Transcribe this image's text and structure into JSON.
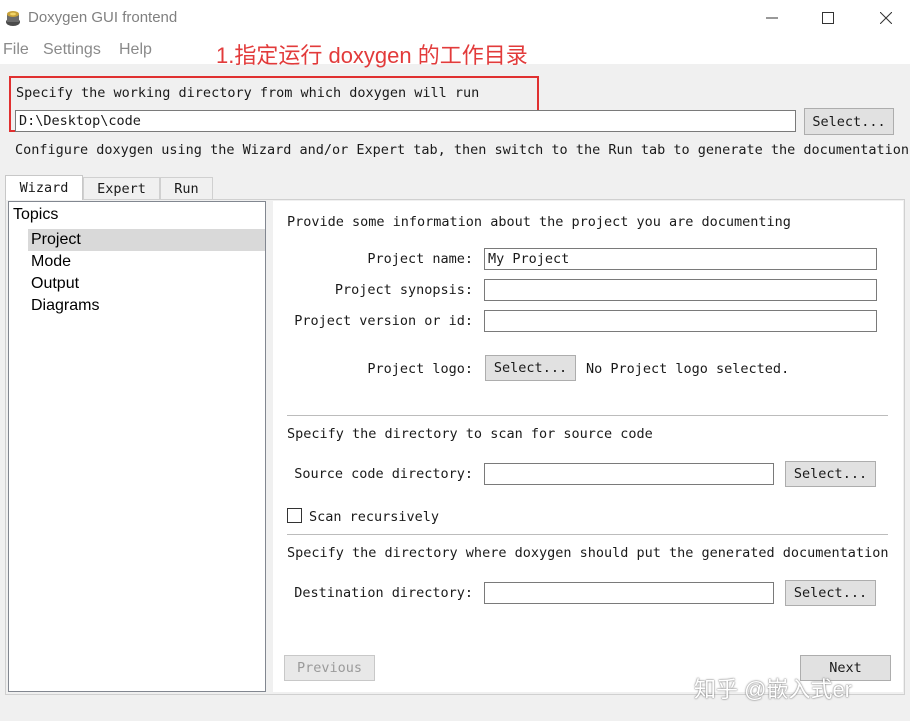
{
  "window": {
    "title": "Doxygen GUI frontend"
  },
  "menu": {
    "items": [
      "File",
      "Settings",
      "Help"
    ]
  },
  "annotation": {
    "text": "1.指定运行 doxygen 的工作目录",
    "color": "#e23b3b"
  },
  "working_dir": {
    "label": "Specify the working directory from which doxygen will run",
    "value": "D:\\Desktop\\code",
    "select_label": "Select..."
  },
  "configure_text": "Configure doxygen using the Wizard and/or Expert tab, then switch to the Run tab to generate the documentation",
  "tabs": [
    "Wizard",
    "Expert",
    "Run"
  ],
  "topics": {
    "header": "Topics",
    "items": [
      "Project",
      "Mode",
      "Output",
      "Diagrams"
    ],
    "selected": "Project"
  },
  "project": {
    "intro": "Provide some information about the project you are documenting",
    "name_label": "Project name:",
    "name_value": "My Project",
    "synopsis_label": "Project synopsis:",
    "synopsis_value": "",
    "version_label": "Project version or id:",
    "version_value": "",
    "logo_label": "Project logo:",
    "logo_select": "Select...",
    "logo_status": "No Project logo selected."
  },
  "source": {
    "intro": "Specify the directory to scan for source code",
    "dir_label": "Source code directory:",
    "dir_value": "",
    "select_label": "Select...",
    "recursive_label": "Scan recursively",
    "recursive_checked": false
  },
  "destination": {
    "intro": "Specify the directory where doxygen should put the generated documentation",
    "dir_label": "Destination directory:",
    "dir_value": "",
    "select_label": "Select..."
  },
  "nav": {
    "previous": "Previous",
    "next": "Next"
  },
  "watermark": "知乎 @嵌入式er"
}
